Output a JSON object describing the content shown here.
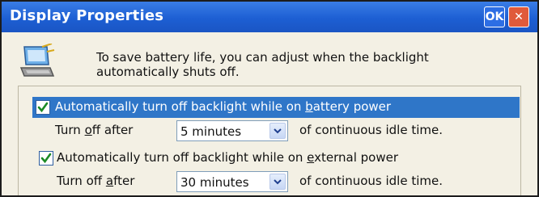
{
  "window": {
    "title": "Display Properties",
    "ok_label": "OK"
  },
  "description": {
    "line1": "To save battery life, you can adjust when the backlight",
    "line2": "automatically shuts off."
  },
  "battery": {
    "checked": true,
    "label_prefix": "Automatically turn off backlight while on ",
    "label_underlined": "b",
    "label_suffix": "attery power",
    "turn_off_prefix": "Turn ",
    "turn_off_underlined": "o",
    "turn_off_suffix": "ff after",
    "selected_value": "5 minutes",
    "tail": "of continuous idle time."
  },
  "external": {
    "checked": true,
    "label_prefix": "Automatically turn off backlight while on ",
    "label_underlined": "e",
    "label_suffix": "xternal power",
    "turn_off_prefix": "Turn off ",
    "turn_off_underlined": "a",
    "turn_off_suffix": "fter",
    "selected_value": "30 minutes",
    "tail": "of continuous idle time."
  },
  "colors": {
    "titlebar": "#1d5fd3",
    "selection": "#2f76c8",
    "background": "#f3f0e4",
    "close": "#e05a3a"
  },
  "icons": [
    "laptop-backlight-icon",
    "checkmark-icon",
    "dropdown-arrow-icon",
    "close-icon"
  ]
}
